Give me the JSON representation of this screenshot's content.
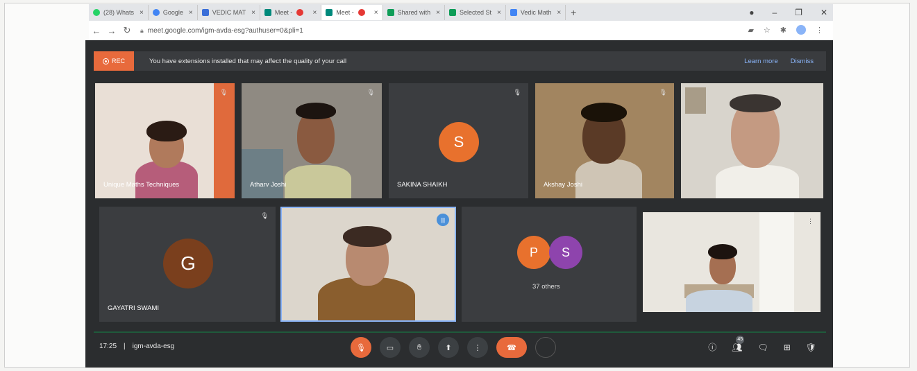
{
  "browser": {
    "tabs": [
      {
        "label": "(28) Whats",
        "color": "#25d366"
      },
      {
        "label": "Google",
        "color": "#4285f4"
      },
      {
        "label": "VEDIC MAT",
        "color": "#3b6fd8"
      },
      {
        "label": "Meet -",
        "color": "#00897b"
      },
      {
        "label": "Meet -",
        "color": "#00897b"
      },
      {
        "label": "Shared with",
        "color": "#0f9d58"
      },
      {
        "label": "Selected St",
        "color": "#0f9d58"
      },
      {
        "label": "Vedic Math",
        "color": "#4285f4"
      }
    ],
    "url": "meet.google.com/igm-avda-esg?authuser=0&pli=1"
  },
  "banner": {
    "rec_label": "REC",
    "message": "You have extensions installed that may affect the quality of your call",
    "learn_more": "Learn more",
    "dismiss": "Dismiss"
  },
  "participants": [
    {
      "name": "Unique Maths Techniques"
    },
    {
      "name": "Atharv Joshi"
    },
    {
      "name": "SAKINA SHAIKH",
      "initial": "S",
      "avatar_color": "#e8712d"
    },
    {
      "name": "Akshay Joshi"
    },
    {
      "name": ""
    },
    {
      "name": "GAYATRI SWAMI",
      "initial": "G",
      "avatar_color": "#7a3f1d"
    },
    {
      "name": ""
    },
    {
      "name": ""
    }
  ],
  "others": {
    "label": "37 others",
    "initials": [
      "P",
      "S"
    ],
    "colors": [
      "#e8712d",
      "#8e44ad"
    ]
  },
  "meeting": {
    "time": "17:25",
    "code": "igm-avda-esg",
    "people_count": "45"
  },
  "colors": {
    "accent": "#e86a3c",
    "meet_bg": "#2b2d2f",
    "tile_bg": "#3b3d40"
  }
}
